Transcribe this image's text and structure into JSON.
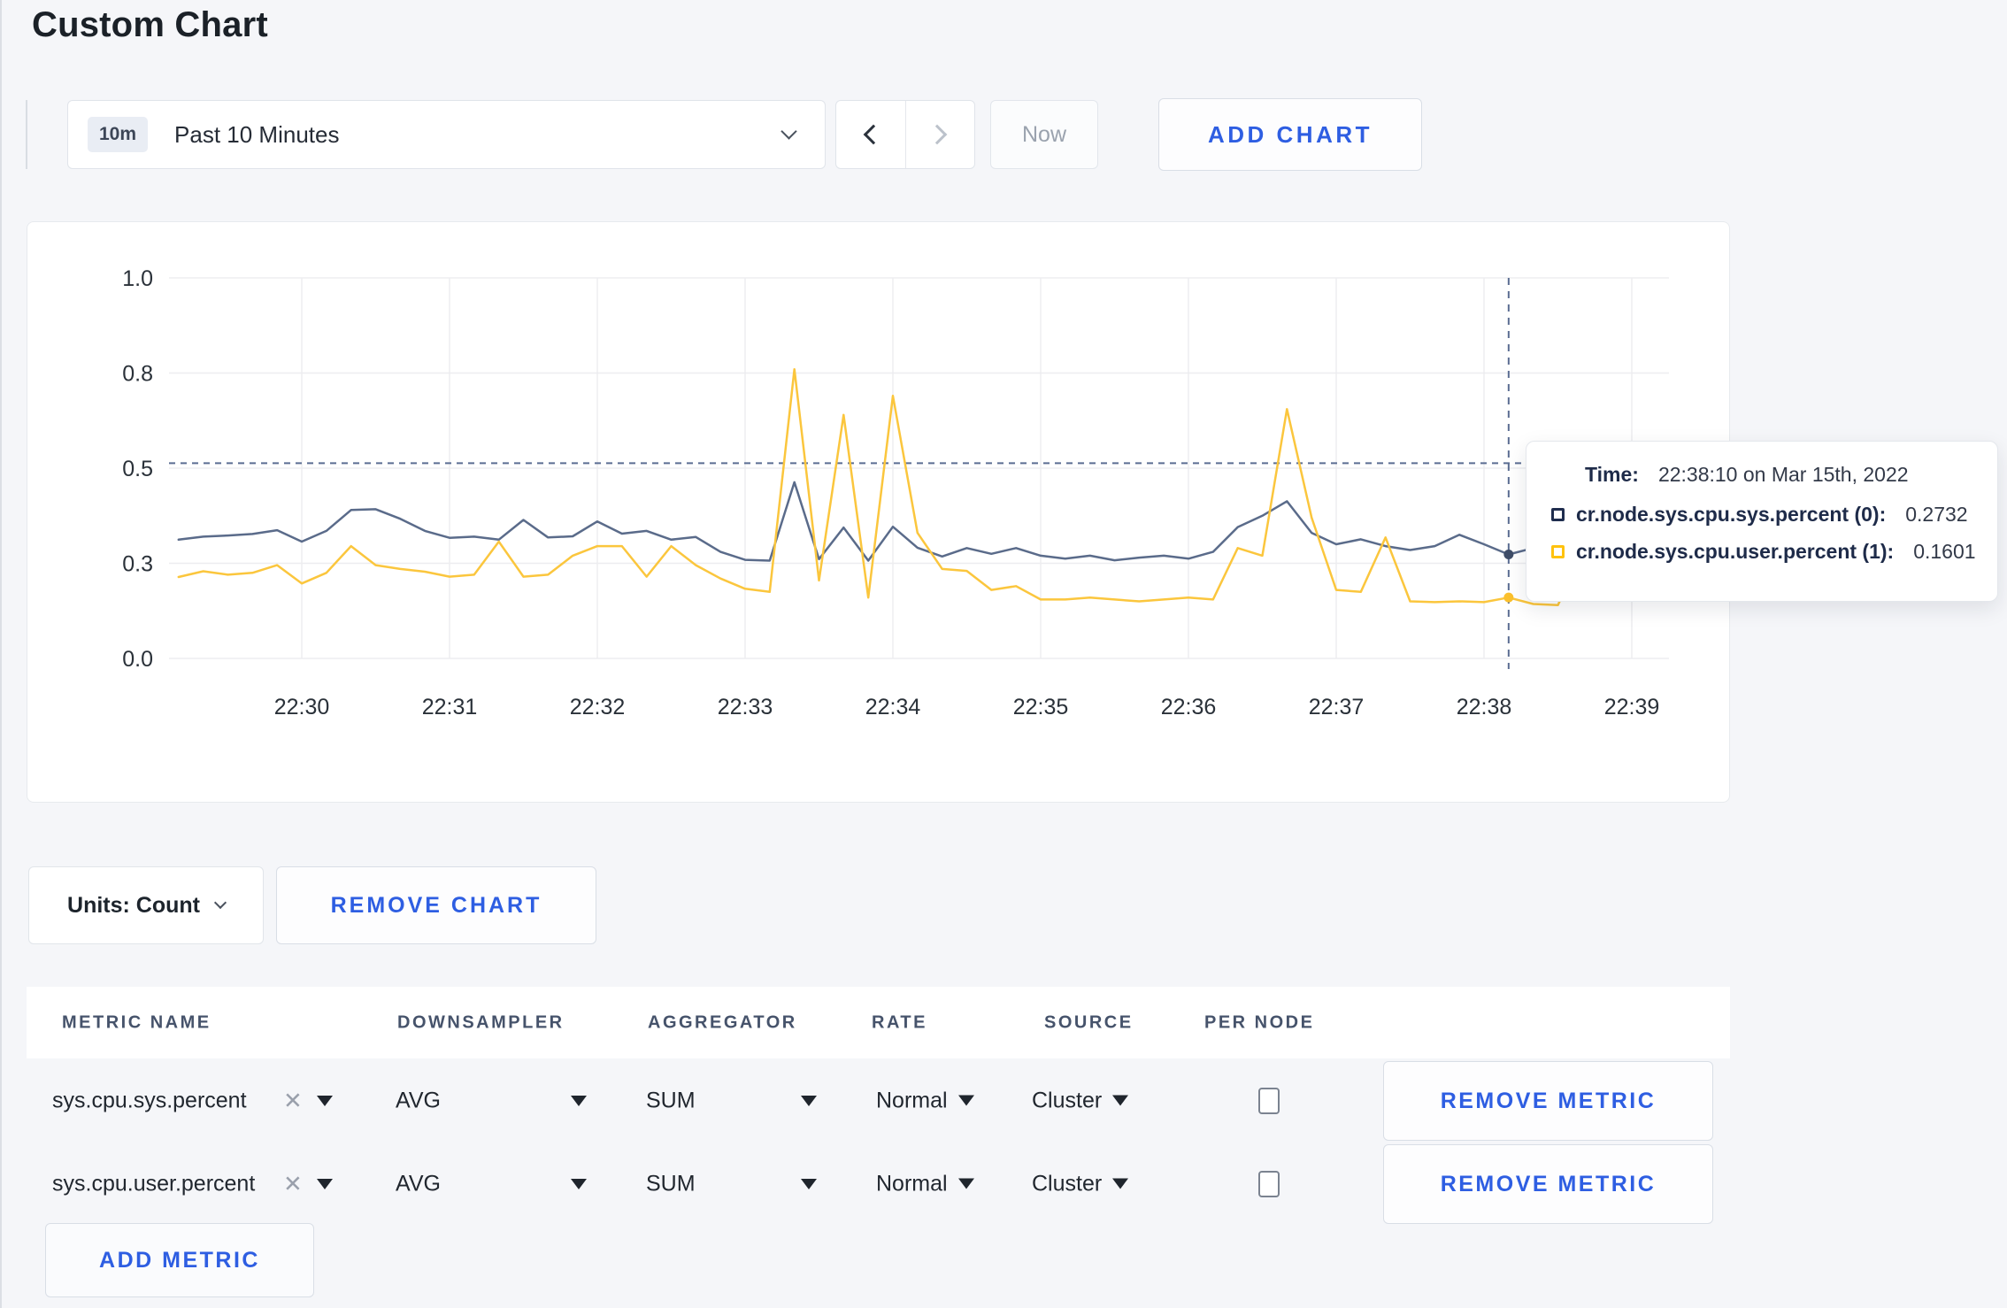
{
  "page": {
    "title": "Custom Chart"
  },
  "colors": {
    "accent_blue": "#2e5ee2",
    "series_sys": "#5a6b8a",
    "series_user": "#fbc63d",
    "tooltip_sys_square": "#1f2d4e",
    "tooltip_user_square": "#ffc20e",
    "crosshair": "#5b6d92",
    "gridline": "#ededf0",
    "page_background": "#f5f6f9"
  },
  "toolbar": {
    "time_range": {
      "badge": "10m",
      "label": "Past 10 Minutes"
    },
    "now_label": "Now",
    "add_chart_label": "ADD CHART"
  },
  "chart_data": {
    "type": "line",
    "title": "",
    "xlabel": "",
    "ylabel": "",
    "ylim": [
      0,
      1
    ],
    "grid": true,
    "x_start": "22:29:10",
    "x_step_seconds": 10,
    "x_tick_labels": [
      "22:30",
      "22:31",
      "22:32",
      "22:33",
      "22:34",
      "22:35",
      "22:36",
      "22:37",
      "22:38",
      "22:39"
    ],
    "y_tick_labels": [
      "0.0",
      "0.3",
      "0.5",
      "0.8",
      "1.0"
    ],
    "y_tick_values": [
      0,
      0.25,
      0.5,
      0.75,
      1.0
    ],
    "series": [
      {
        "name": "cr.node.sys.cpu.sys.percent (0)",
        "color": "#5a6b8a",
        "values": [
          0.312,
          0.32,
          0.323,
          0.327,
          0.337,
          0.307,
          0.335,
          0.39,
          0.392,
          0.367,
          0.335,
          0.317,
          0.32,
          0.312,
          0.364,
          0.318,
          0.321,
          0.36,
          0.328,
          0.335,
          0.312,
          0.319,
          0.28,
          0.259,
          0.257,
          0.463,
          0.261,
          0.344,
          0.257,
          0.346,
          0.291,
          0.268,
          0.29,
          0.275,
          0.29,
          0.27,
          0.262,
          0.27,
          0.258,
          0.265,
          0.27,
          0.262,
          0.28,
          0.345,
          0.375,
          0.413,
          0.33,
          0.3,
          0.313,
          0.295,
          0.285,
          0.295,
          0.325,
          0.3,
          0.2732,
          0.29,
          0.272,
          0.3,
          0.306,
          0.303,
          0.305
        ]
      },
      {
        "name": "cr.node.sys.cpu.user.percent (1)",
        "color": "#fbc63d",
        "values": [
          0.214,
          0.229,
          0.22,
          0.225,
          0.245,
          0.197,
          0.225,
          0.295,
          0.245,
          0.235,
          0.228,
          0.215,
          0.22,
          0.307,
          0.215,
          0.22,
          0.27,
          0.295,
          0.295,
          0.215,
          0.295,
          0.245,
          0.21,
          0.183,
          0.175,
          0.76,
          0.205,
          0.64,
          0.16,
          0.69,
          0.33,
          0.235,
          0.23,
          0.18,
          0.19,
          0.155,
          0.155,
          0.16,
          0.155,
          0.15,
          0.155,
          0.16,
          0.155,
          0.29,
          0.27,
          0.655,
          0.37,
          0.18,
          0.175,
          0.318,
          0.15,
          0.148,
          0.15,
          0.148,
          0.1601,
          0.143,
          0.14,
          0.28,
          0.283,
          0.17,
          0.27
        ]
      }
    ],
    "crosshair": {
      "time": "22:38:10",
      "hline_value": 0.513,
      "highlight": [
        {
          "series": 0,
          "value": 0.2732,
          "dot_color": "#3f4d68"
        },
        {
          "series": 1,
          "value": 0.1601,
          "dot_color": "#fbc02d"
        }
      ]
    },
    "legend_position": "tooltip"
  },
  "tooltip": {
    "time_label": "Time:",
    "time_value": "22:38:10 on Mar 15th, 2022",
    "series": [
      {
        "label": "cr.node.sys.cpu.sys.percent (0):",
        "value": "0.2732",
        "square_color": "#1f2d4e"
      },
      {
        "label": "cr.node.sys.cpu.user.percent (1):",
        "value": "0.1601",
        "square_color": "#ffc20e"
      }
    ]
  },
  "chart_controls": {
    "units_label": "Units: Count",
    "remove_chart_label": "REMOVE CHART"
  },
  "metrics_table": {
    "headers": [
      "METRIC NAME",
      "DOWNSAMPLER",
      "AGGREGATOR",
      "RATE",
      "SOURCE",
      "PER NODE"
    ],
    "rows": [
      {
        "metric": "sys.cpu.sys.percent",
        "remove_icon": "✕",
        "downsampler": "AVG",
        "aggregator": "SUM",
        "rate": "Normal",
        "source": "Cluster",
        "per_node_checked": false,
        "remove_label": "REMOVE METRIC"
      },
      {
        "metric": "sys.cpu.user.percent",
        "remove_icon": "✕",
        "downsampler": "AVG",
        "aggregator": "SUM",
        "rate": "Normal",
        "source": "Cluster",
        "per_node_checked": false,
        "remove_label": "REMOVE METRIC"
      }
    ],
    "add_metric_label": "ADD METRIC"
  }
}
